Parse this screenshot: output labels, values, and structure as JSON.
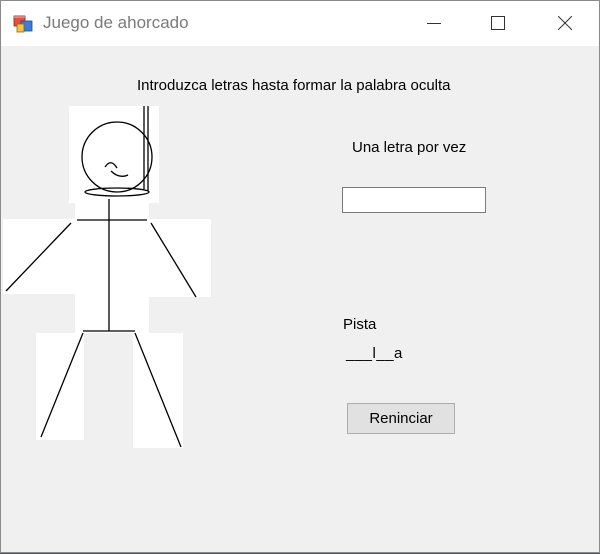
{
  "window": {
    "title": "Juego de ahorcado",
    "controls": {
      "minimize_icon": "minimize-icon",
      "maximize_icon": "maximize-icon",
      "close_icon": "close-icon"
    }
  },
  "labels": {
    "instructions": "Introduzca letras hasta formar la palabra oculta",
    "one_letter": "Una letra por vez",
    "hint_title": "Pista",
    "masked_word": "___l__a"
  },
  "letter_input": {
    "value": "",
    "placeholder": ""
  },
  "buttons": {
    "restart": "Reninciar"
  },
  "hangman": {
    "parts": [
      "rope",
      "head",
      "face",
      "body",
      "left-arm",
      "right-arm",
      "left-leg",
      "right-leg"
    ]
  },
  "colors": {
    "window_bg": "#f0f0f0",
    "titlebar_bg": "#ffffff",
    "title_text": "#7a7a7a",
    "drawing": "#000000"
  }
}
